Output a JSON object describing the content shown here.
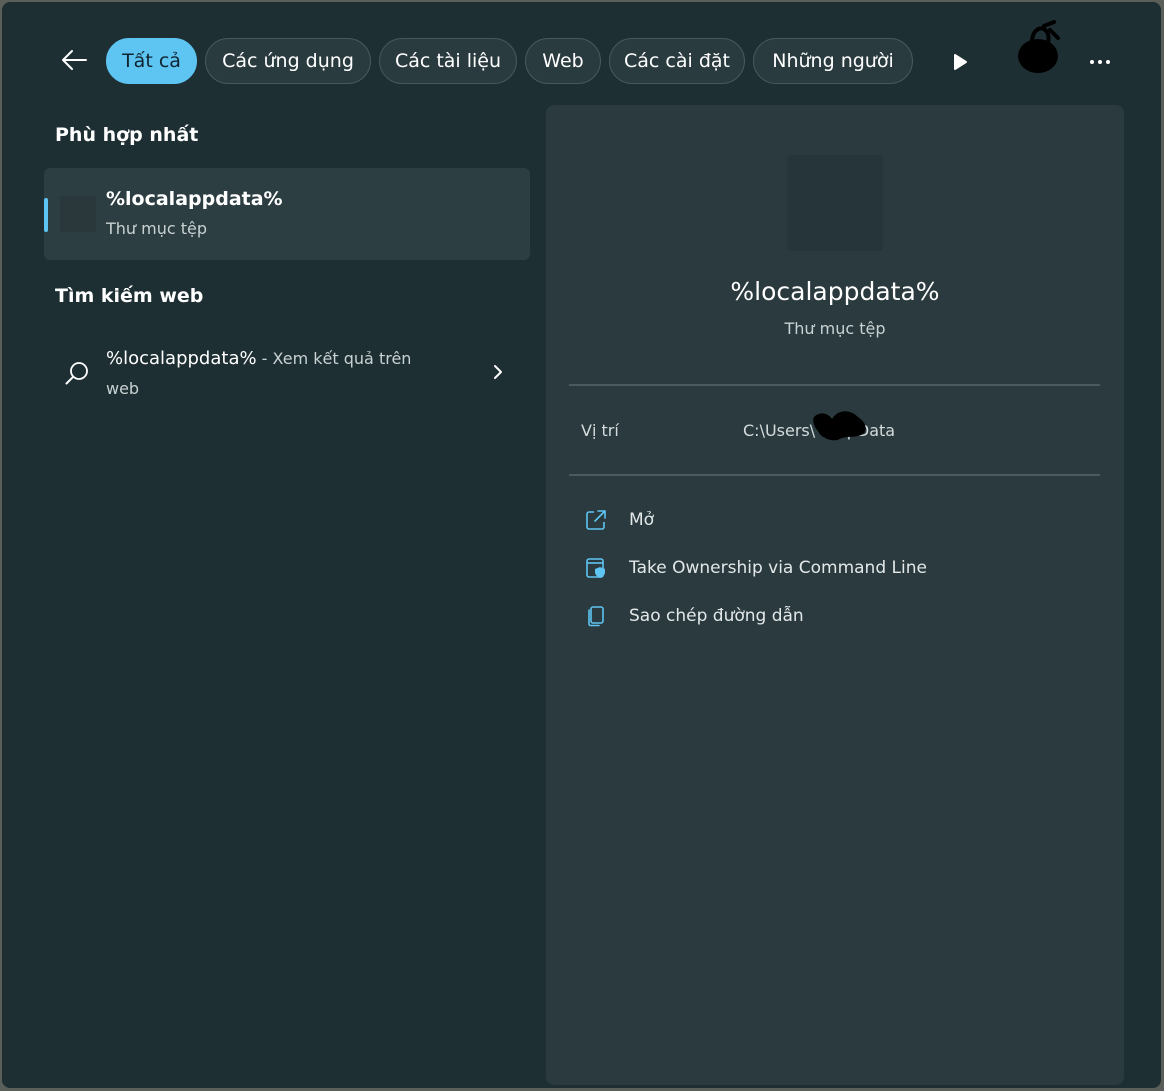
{
  "filters": {
    "back_icon": "back-arrow-icon",
    "tabs": [
      {
        "label": "Tất cả",
        "active": true
      },
      {
        "label": "Các ứng dụng",
        "active": false
      },
      {
        "label": "Các tài liệu",
        "active": false
      },
      {
        "label": "Web",
        "active": false
      },
      {
        "label": "Các cài đặt",
        "active": false
      },
      {
        "label": "Những người",
        "active": false
      }
    ]
  },
  "best_match": {
    "heading": "Phù hợp nhất",
    "name": "%localappdata%",
    "type": "Thư mục tệp"
  },
  "web_search": {
    "heading": "Tìm kiếm web",
    "query": "%localappdata%",
    "suffix": " - Xem kết quả trên web"
  },
  "detail": {
    "title": "%localappdata%",
    "subtitle": "Thư mục tệp",
    "location_label": "Vị trí",
    "location_value": "C:\\Users\\          \\AppData",
    "actions": [
      {
        "label": "Mở",
        "icon": "open-external-icon"
      },
      {
        "label": "Take Ownership via Command Line",
        "icon": "shield-window-icon"
      },
      {
        "label": "Sao chép đường dẫn",
        "icon": "copy-path-icon"
      }
    ]
  },
  "colors": {
    "accent": "#5ec4f2",
    "window_bg": "#1e2f33",
    "panel_bg": "#2a3a3e"
  }
}
